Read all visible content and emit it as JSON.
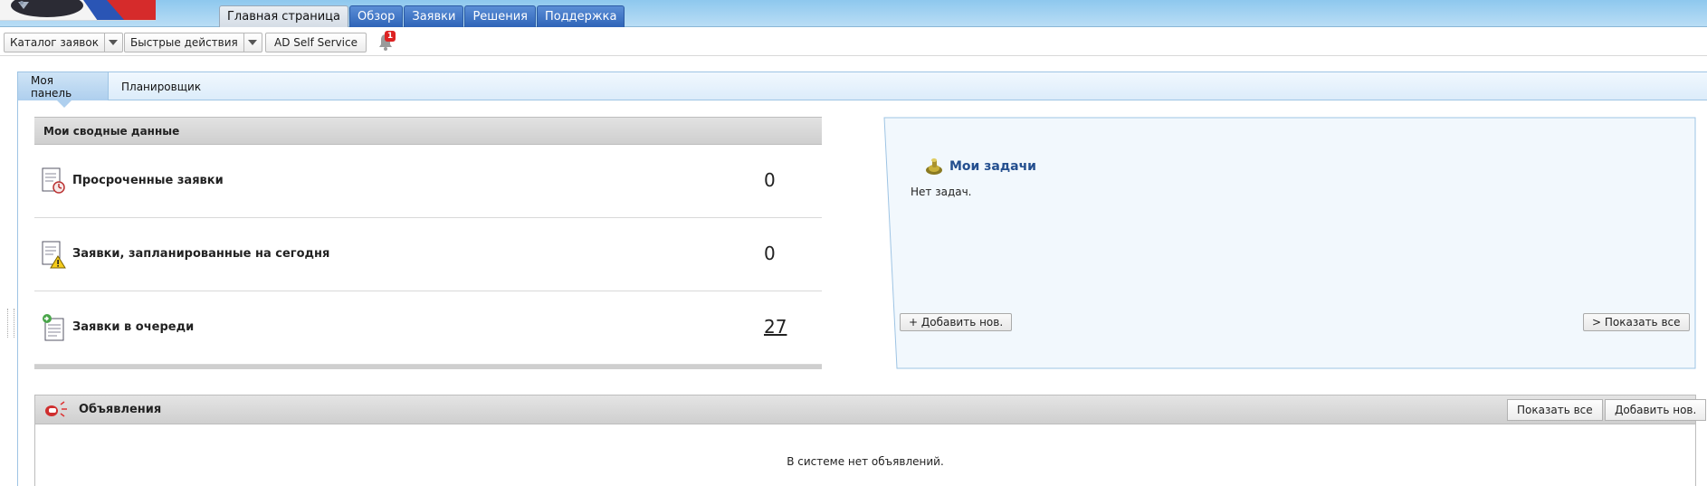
{
  "header": {
    "nav_tabs": [
      {
        "label": "Главная страница",
        "active": true
      },
      {
        "label": "Обзор",
        "active": false
      },
      {
        "label": "Заявки",
        "active": false
      },
      {
        "label": "Решения",
        "active": false
      },
      {
        "label": "Поддержка",
        "active": false
      }
    ]
  },
  "toolbar": {
    "catalog_label": "Каталог заявок",
    "quick_actions_label": "Быстрые действия",
    "ad_self_service_label": "AD Self Service",
    "notification_count": "1"
  },
  "subtabs": [
    {
      "label": "Моя панель",
      "active": true
    },
    {
      "label": "Планировщик",
      "active": false
    }
  ],
  "summary": {
    "title": "Мои сводные данные",
    "rows": [
      {
        "label": "Просроченные заявки",
        "value": "0",
        "icon": "overdue-requests-icon"
      },
      {
        "label": "Заявки, запланированные на сегодня",
        "value": "0",
        "icon": "due-today-warning-icon"
      },
      {
        "label": "Заявки в очереди",
        "value": "27",
        "icon": "queue-requests-icon",
        "link": true
      }
    ]
  },
  "tasks": {
    "title": "Мои задачи",
    "empty_text": "Нет задач.",
    "add_button": "+ Добавить нов.",
    "show_all_button": "> Показать все"
  },
  "announcements": {
    "title": "Объявления",
    "show_all_button": "Показать все",
    "add_button": "Добавить нов.",
    "empty_text": "В системе нет объявлений."
  },
  "colors": {
    "header_band": "#8ec8ee",
    "nav_tab": "#2e64b8",
    "tasks_title": "#244f8f",
    "badge": "#dd2222"
  }
}
